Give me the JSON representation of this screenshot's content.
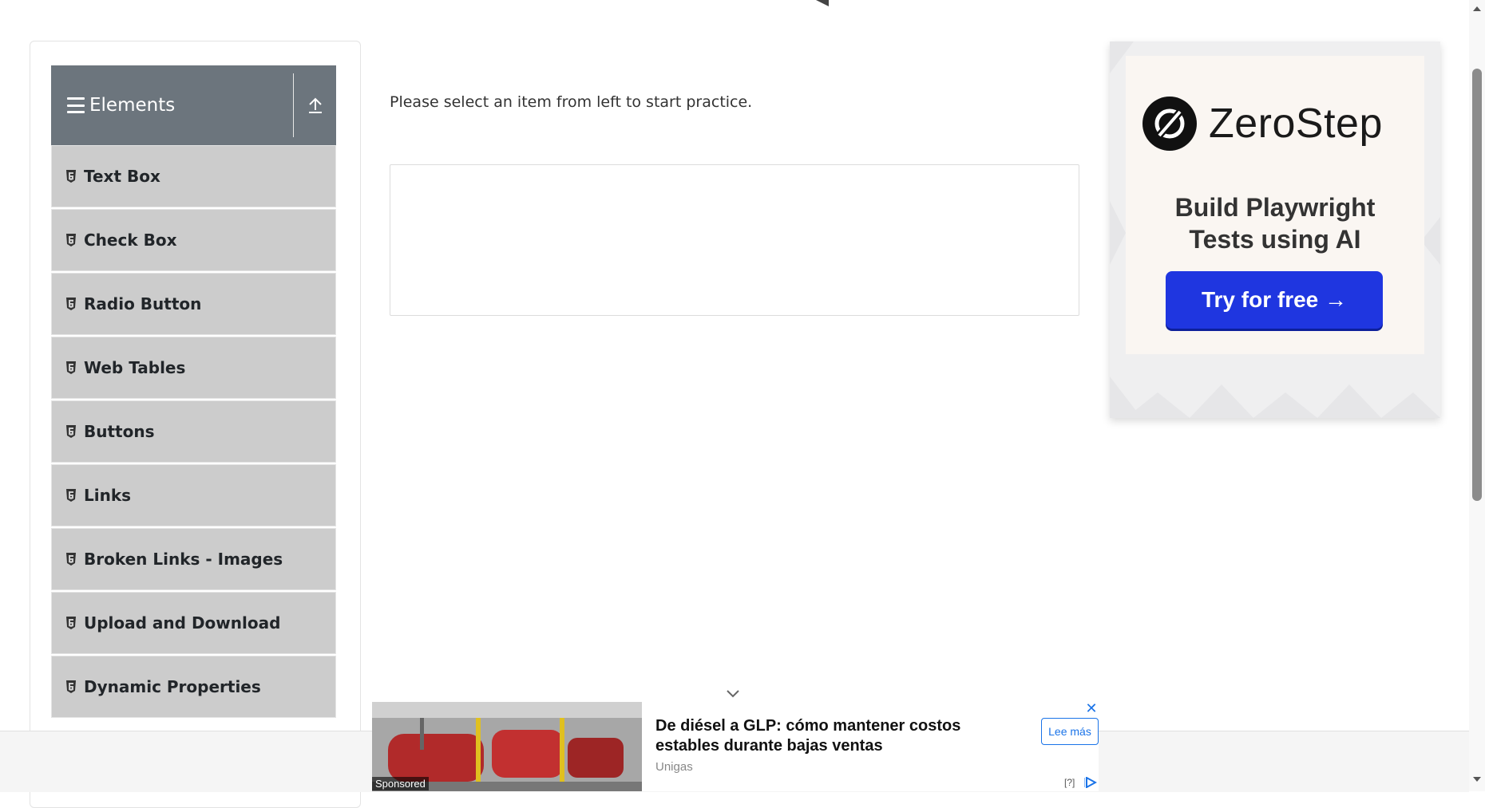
{
  "sidebar": {
    "group_title": "Elements",
    "items": [
      {
        "label": "Text Box"
      },
      {
        "label": "Check Box"
      },
      {
        "label": "Radio Button"
      },
      {
        "label": "Web Tables"
      },
      {
        "label": "Buttons"
      },
      {
        "label": "Links"
      },
      {
        "label": "Broken Links - Images"
      },
      {
        "label": "Upload and Download"
      },
      {
        "label": "Dynamic Properties"
      }
    ]
  },
  "main": {
    "intro_text": "Please select an item from left to start practice."
  },
  "ad_right": {
    "brand": "ZeroStep",
    "headline_line1": "Build Playwright",
    "headline_line2": "Tests using AI",
    "cta": "Try for free →",
    "colors": {
      "cta": "#1f36e0",
      "panel": "#faf6f2"
    }
  },
  "ad_bottom": {
    "title": "De diésel a GLP: cómo mantener costos estables durante bajas ventas",
    "advertiser": "Unigas",
    "read_more": "Lee más",
    "sponsored": "Sponsored",
    "info": "[?]"
  },
  "colors": {
    "header": "#6c757d",
    "menu_item": "#cccccc"
  }
}
